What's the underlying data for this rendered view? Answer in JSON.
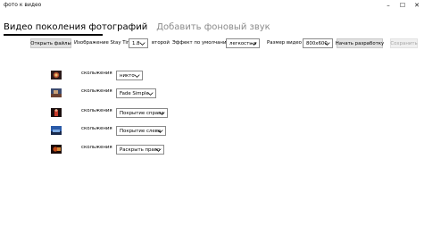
{
  "window": {
    "title": "фото к видео",
    "min": "–",
    "max": "☐",
    "close": "✕"
  },
  "tabs": [
    {
      "label": "Видео поколения фотографий"
    },
    {
      "label": "Добавить фоновый звук"
    }
  ],
  "toolbar": {
    "open_files": "Открыть файлы",
    "stay_time_label": "Изображение Stay Time",
    "stay_time_value": "1.8",
    "seconds_label": "второй",
    "default_effect_label": "Эффект по умолчанию",
    "default_effect_value": "легкость в",
    "video_size_label": "Размер видео",
    "video_size_value": "800x600",
    "start_button": "Начать разработку",
    "save_button": "Сохранить"
  },
  "rows": [
    {
      "thumb": "photo-thumbnail",
      "label": "скольжения",
      "effect": "никто"
    },
    {
      "thumb": "photo-thumbnail",
      "label": "скольжения",
      "effect": "Fade Simple"
    },
    {
      "thumb": "photo-thumbnail",
      "label": "скольжения",
      "effect": "Покрытие справа"
    },
    {
      "thumb": "photo-thumbnail",
      "label": "скольжения",
      "effect": "Покрытие слева"
    },
    {
      "thumb": "photo-thumbnail",
      "label": "скольжения",
      "effect": "Раскрыть право"
    }
  ],
  "colors": {
    "accent_border": "#6b6b6b",
    "disabled_text": "#a5a5a5",
    "inactive_tab": "#8b8b8b"
  }
}
